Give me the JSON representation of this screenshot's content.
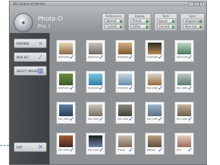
{
  "window": {
    "title": "Nik Creative IO Monitor"
  },
  "app": {
    "name": "Photo-O",
    "subtitle": "Pro I"
  },
  "groups": [
    {
      "label": "Preferences",
      "buttons": [
        "Normal",
        "Custom"
      ]
    },
    {
      "label": "Display",
      "buttons": [
        "Preset",
        "Editor"
      ]
    },
    {
      "label": "Tools",
      "buttons": [
        "Ignore",
        "Convert"
      ]
    },
    {
      "label": "Save",
      "buttons": [
        "Original size",
        "New size"
      ]
    }
  ],
  "sidebar": {
    "preview": "PREVIEW",
    "new_set": "NEW SET",
    "select_images": "SELECT IMAGES",
    "exit": "EXIT"
  },
  "thumbnails": [
    {
      "caption": "DSCF1930",
      "colors": [
        "#e7d8b5",
        "#8a6a48"
      ]
    },
    {
      "caption": "DSCF1920",
      "colors": [
        "#c9c6bf",
        "#6e6a66"
      ]
    },
    {
      "caption": "DSCF0000",
      "colors": [
        "#d4b07f",
        "#7a5730"
      ]
    },
    {
      "caption": "DSCF0000",
      "colors": [
        "#2b2a28",
        "#b98b55"
      ]
    },
    {
      "caption": "DSCF1240",
      "colors": [
        "#bfd6c8",
        "#4d7a5e"
      ]
    },
    {
      "caption": "DSCF1971",
      "colors": [
        "#6c8e3b",
        "#3b5a2a"
      ]
    },
    {
      "caption": "DSCF1970",
      "colors": [
        "#7fc3e0",
        "#2f7fa8"
      ]
    },
    {
      "caption": "DSCF1971",
      "colors": [
        "#c7d8e4",
        "#6c8aa3"
      ]
    },
    {
      "caption": "DSC_0000",
      "colors": [
        "#d9d4cc",
        "#9b6a3a"
      ]
    },
    {
      "caption": "DSC_0000",
      "colors": [
        "#b9c9c2",
        "#5f7b6a"
      ]
    },
    {
      "caption": "DSC_4200",
      "colors": [
        "#5b7fa5",
        "#2b3f55"
      ]
    },
    {
      "caption": "DSC_4200",
      "colors": [
        "#c9c4b8",
        "#767066"
      ]
    },
    {
      "caption": "DSC_4200",
      "colors": [
        "#8a8b7c",
        "#3f4034"
      ]
    },
    {
      "caption": "DSC_4200",
      "colors": [
        "#9fb5cc",
        "#5a6f86"
      ]
    },
    {
      "caption": "DSC_4200",
      "colors": [
        "#c4b29a",
        "#6e5e4a"
      ]
    },
    {
      "caption": "DSC_4200",
      "colors": [
        "#a55a3a",
        "#3f2a20"
      ]
    },
    {
      "caption": "DSC_4200",
      "colors": [
        "#1c1d22",
        "#6e7fa8"
      ]
    },
    {
      "caption": "Friends",
      "colors": [
        "#c9bfb2",
        "#7d6a58"
      ]
    },
    {
      "caption": "Website",
      "colors": [
        "#b8a07c",
        "#5e4f3b"
      ]
    },
    {
      "caption": "Nina",
      "colors": [
        "#e6cdbf",
        "#9b6b58"
      ]
    }
  ]
}
